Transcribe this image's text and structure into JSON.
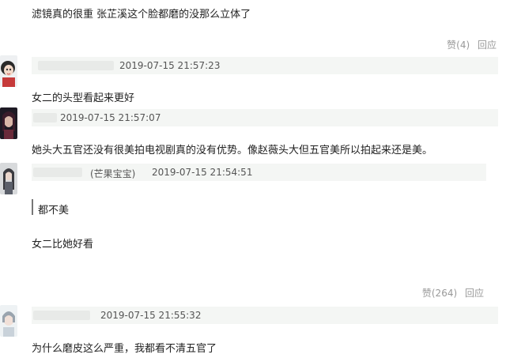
{
  "top_comment": {
    "text": "滤镜真的很重 张芷溪这个脸都磨的没那么立体了",
    "like_label": "赞",
    "like_count": "(4)",
    "reply_label": "回应"
  },
  "comments": [
    {
      "username": "",
      "timestamp": "2019-07-15 21:57:23",
      "text": "女二的头型看起来更好"
    },
    {
      "username": "",
      "timestamp": "2019-07-15 21:57:07",
      "text": "她头大五官还没有很美拍电视剧真的没有优势。像赵薇头大但五官美所以拍起来还是美。"
    },
    {
      "username": "(芒果宝宝)",
      "timestamp": "2019-07-15 21:54:51",
      "quote": "都不美",
      "text": "女二比她好看",
      "like_label": "赞",
      "like_count": "(264)",
      "reply_label": "回应"
    },
    {
      "username": "",
      "timestamp": "2019-07-15 21:55:32",
      "text": "为什么磨皮这么严重，我都看不清五官了"
    }
  ],
  "colors": {
    "header_bar": "#f4f6f4",
    "meta_text": "#555555",
    "action_text": "#999999"
  }
}
